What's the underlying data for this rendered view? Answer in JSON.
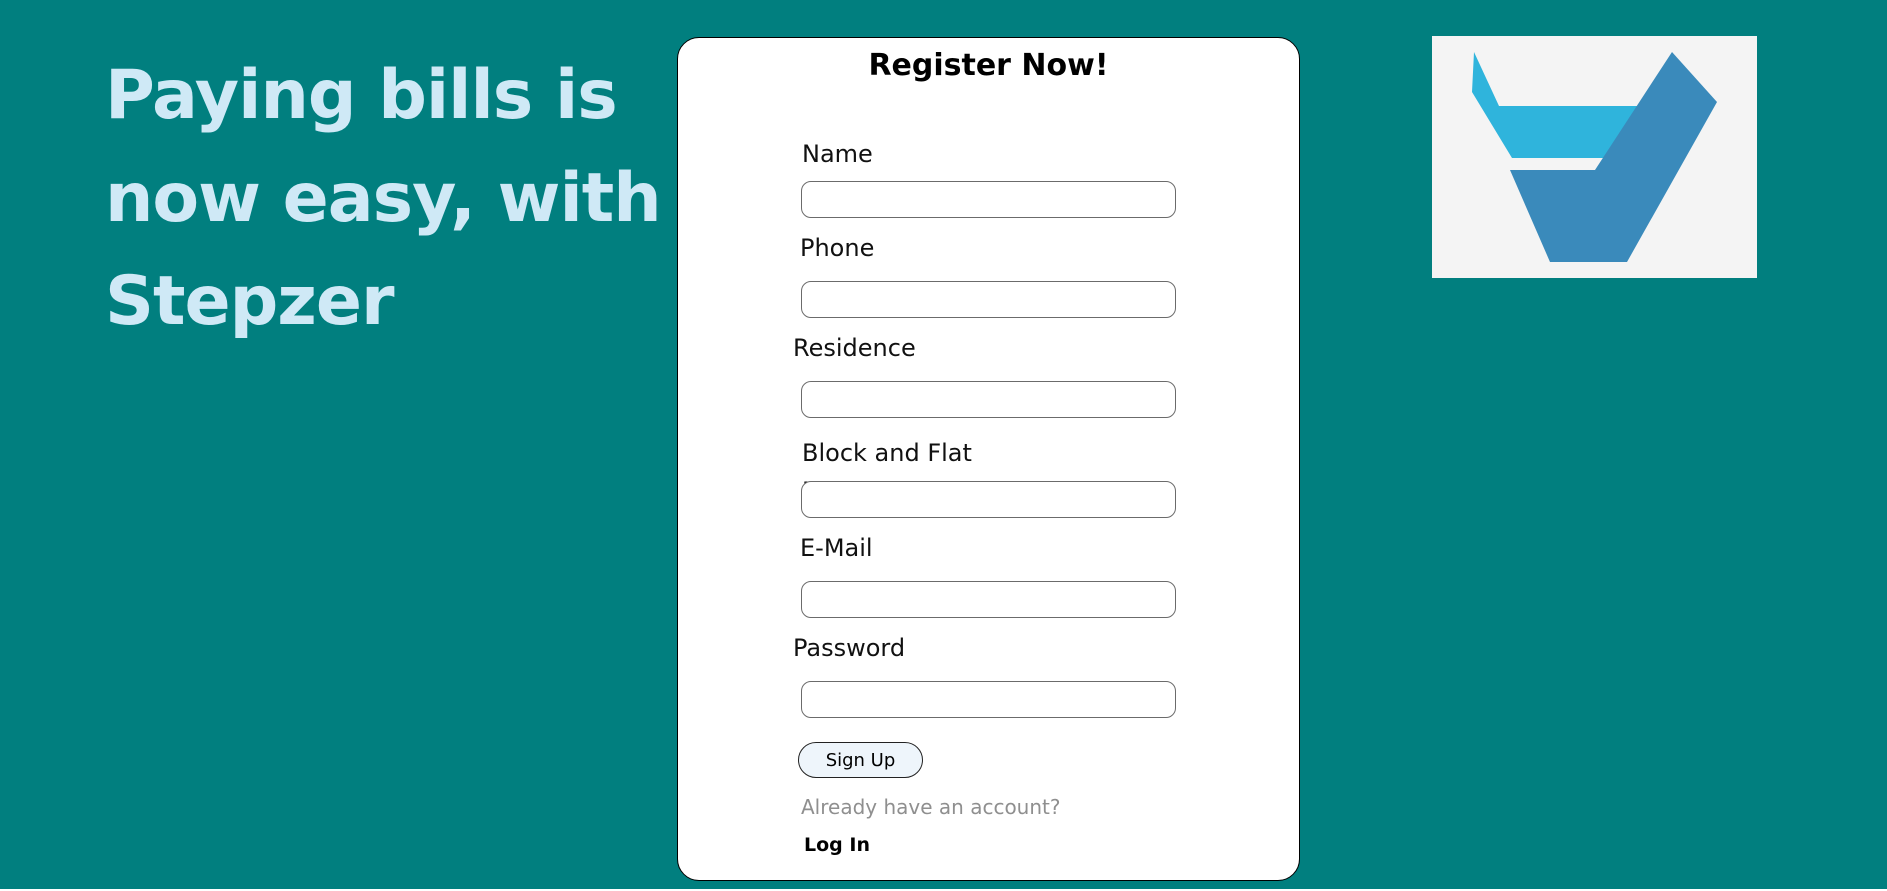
{
  "hero": {
    "tagline": "Paying bills is now easy, with Stepzer"
  },
  "form": {
    "title": "Register Now!",
    "fields": [
      {
        "label": "Name",
        "value": "",
        "placeholder": ""
      },
      {
        "label": "Phone",
        "value": "",
        "placeholder": ""
      },
      {
        "label": "Residence",
        "value": "",
        "placeholder": ""
      },
      {
        "label": "Block and Flat No.",
        "value": "",
        "placeholder": ""
      },
      {
        "label": "E-Mail",
        "value": "",
        "placeholder": ""
      },
      {
        "label": "Password",
        "value": "",
        "placeholder": ""
      }
    ],
    "submit_label": "Sign Up",
    "login_prompt": "Already have an account?",
    "login_link": "Log In"
  },
  "logo": {
    "icon": "stepzer-logo-icon"
  },
  "colors": {
    "background": "#017f7f",
    "tagline": "#cfe9f6",
    "card": "#ffffff",
    "logo_light": "#2fb4dc",
    "logo_dark": "#3a8abb",
    "logo_box": "#f4f4f4",
    "button": "#eef5fb",
    "muted_text": "#8f8f8f"
  }
}
